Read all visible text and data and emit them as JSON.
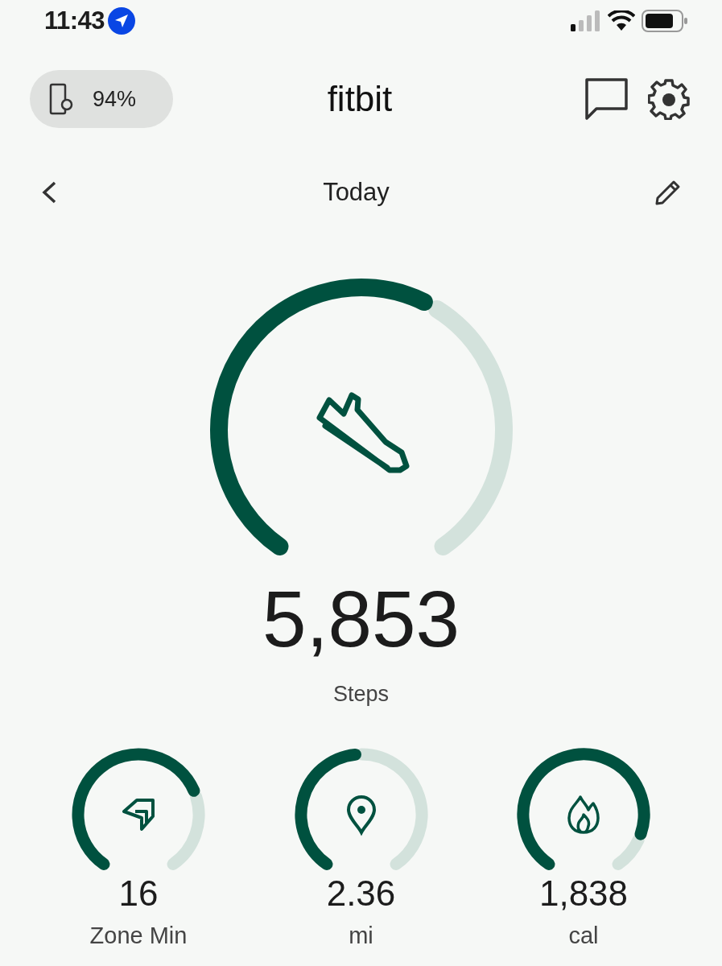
{
  "status_bar": {
    "time": "11:43"
  },
  "header": {
    "battery": "94%",
    "title": "fitbit"
  },
  "date_nav": {
    "label": "Today"
  },
  "main_metric": {
    "value": "5,853",
    "label": "Steps"
  },
  "metrics": [
    {
      "kind": "zone",
      "value": "16",
      "label": "Zone Min"
    },
    {
      "kind": "distance",
      "value": "2.36",
      "label": "mi"
    },
    {
      "kind": "calories",
      "value": "1,838",
      "label": "cal"
    }
  ]
}
